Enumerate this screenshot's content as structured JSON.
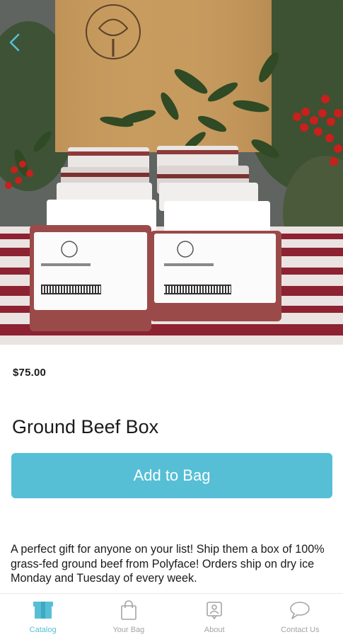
{
  "product": {
    "image_label": "Ground beef box product photo",
    "price": "$75.00",
    "title": "Ground Beef Box",
    "add_button_label": "Add to Bag",
    "description": "A perfect gift for anyone on your list!  Ship them a box of 100% grass-fed ground beef from Polyface!   Orders ship on dry ice Monday and Tuesday of every week."
  },
  "nav": {
    "items": [
      {
        "label": "Catalog",
        "icon": "catalog-icon",
        "active": true
      },
      {
        "label": "Your Bag",
        "icon": "bag-icon",
        "active": false
      },
      {
        "label": "About",
        "icon": "about-icon",
        "active": false
      },
      {
        "label": "Contact Us",
        "icon": "contact-icon",
        "active": false
      }
    ]
  },
  "colors": {
    "accent": "#56bfd6",
    "inactive": "#a4a4a4",
    "text": "#1b1b1b"
  }
}
